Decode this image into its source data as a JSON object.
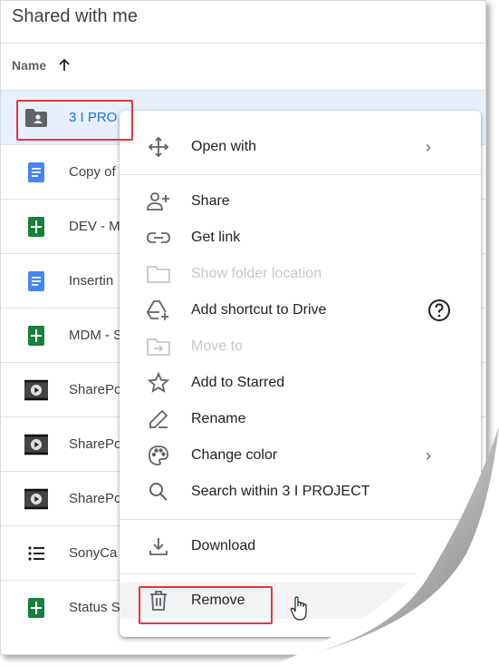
{
  "page": {
    "title": "Shared with me"
  },
  "header": {
    "name_label": "Name"
  },
  "files": [
    {
      "name": "3 I PRO",
      "icon": "shared-folder-icon",
      "selected": true
    },
    {
      "name": "Copy of",
      "icon": "google-docs-icon"
    },
    {
      "name": "DEV - M",
      "icon": "google-sheets-icon"
    },
    {
      "name": "Insertin",
      "icon": "google-docs-icon"
    },
    {
      "name": "MDM - S",
      "icon": "google-sheets-icon"
    },
    {
      "name": "SharePo",
      "icon": "video-icon"
    },
    {
      "name": "SharePo",
      "icon": "video-icon"
    },
    {
      "name": "SharePo",
      "icon": "video-icon"
    },
    {
      "name": "SonyCa",
      "icon": "list-icon"
    },
    {
      "name": "Status S",
      "icon": "google-sheets-icon"
    }
  ],
  "context_menu": {
    "items": [
      {
        "label": "Open with",
        "icon": "open-with-icon",
        "submenu": true
      },
      {
        "label": "Share",
        "icon": "add-person-icon"
      },
      {
        "label": "Get link",
        "icon": "link-icon"
      },
      {
        "label": "Show folder location",
        "icon": "folder-icon",
        "disabled": true
      },
      {
        "label": "Add shortcut to Drive",
        "icon": "add-shortcut-icon",
        "help": true
      },
      {
        "label": "Move to",
        "icon": "move-to-icon",
        "disabled": true
      },
      {
        "label": "Add to Starred",
        "icon": "star-icon"
      },
      {
        "label": "Rename",
        "icon": "pencil-icon"
      },
      {
        "label": "Change color",
        "icon": "palette-icon",
        "submenu": true
      },
      {
        "label": "Search within 3 I PROJECT",
        "icon": "search-icon"
      },
      {
        "label": "Download",
        "icon": "download-icon"
      },
      {
        "label": "Remove",
        "icon": "trash-icon",
        "hover": true
      }
    ]
  },
  "colors": {
    "accent_blue": "#1a73e8",
    "selected_row": "#e8f0fe",
    "highlight_red": "#e33333",
    "sheets_green": "#188038",
    "docs_blue": "#4285f4",
    "icon_gray": "#5f6368"
  }
}
